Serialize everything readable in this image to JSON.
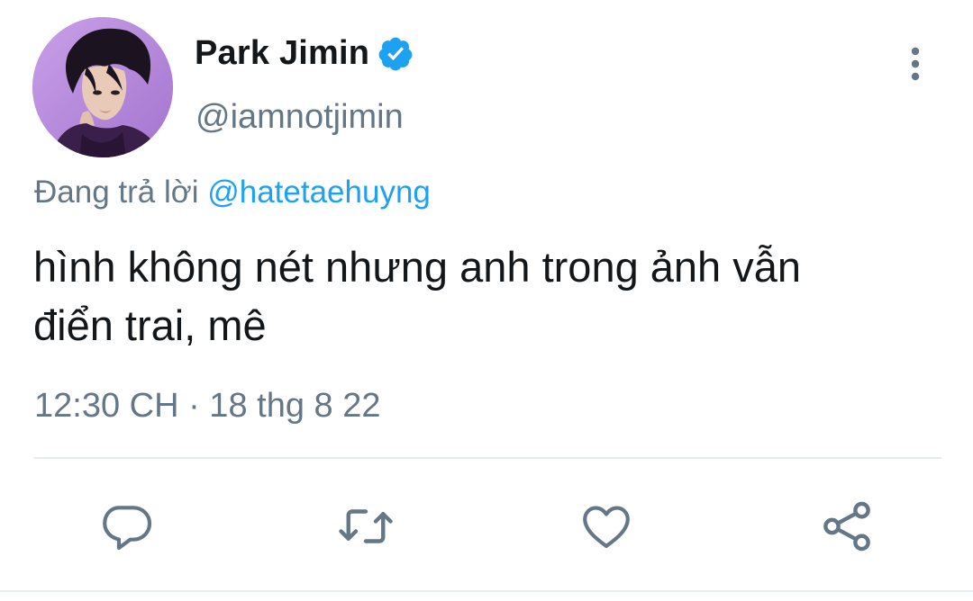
{
  "user": {
    "display_name": "Park Jimin",
    "handle": "@iamnotjimin",
    "verified": true
  },
  "reply": {
    "prefix": "Đang trả lời",
    "mention": "@hatetaehuyng"
  },
  "tweet": {
    "text_line1": "hình không nét nhưng anh trong ảnh vẫn",
    "text_line2": "điển trai, mê",
    "timestamp": "12:30 CH · 18 thg 8 22"
  },
  "actions": [
    {
      "name": "reply",
      "icon": "comment-icon"
    },
    {
      "name": "retweet",
      "icon": "retweet-icon"
    },
    {
      "name": "like",
      "icon": "heart-icon"
    },
    {
      "name": "share",
      "icon": "share-icon"
    }
  ],
  "colors": {
    "primary_text": "#14171a",
    "secondary_text": "#657786",
    "accent": "#1da1f2",
    "icon": "#657786"
  }
}
